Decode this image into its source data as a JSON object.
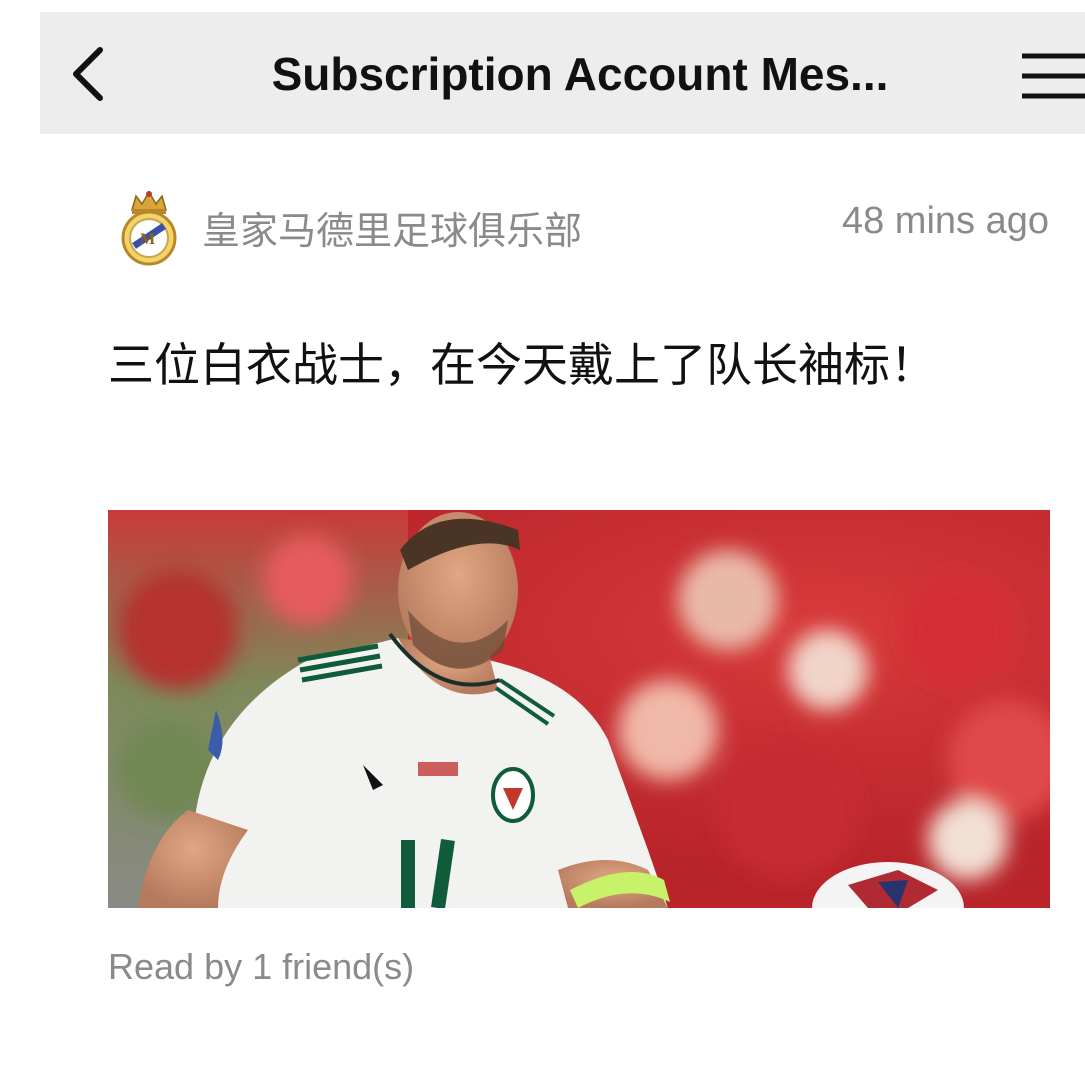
{
  "header": {
    "back_icon": "chevron-left-icon",
    "title": "Subscription Account Mes...",
    "menu_icon": "hamburger-menu-icon"
  },
  "message": {
    "account_name": "皇家马德里足球俱乐部",
    "avatar_icon": "real-madrid-crest-icon",
    "timestamp": "48 mins ago",
    "article_title": "三位白衣战士，在今天戴上了队长袖标！",
    "cover_image": "player-in-white-jersey-number-11-with-captain-armband",
    "read_by": "Read by 1 friend(s)"
  },
  "colors": {
    "navbar_bg": "#ededed",
    "title_text": "#111111",
    "secondary_text": "#8a8a8a",
    "jersey_green": "#0f5b3a",
    "armband": "#c8f26a"
  }
}
